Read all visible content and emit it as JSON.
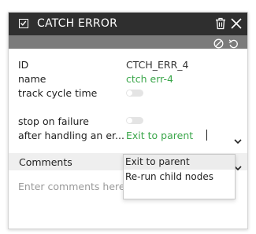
{
  "title_bar": {
    "title": "CATCH ERROR",
    "check_icon": "check-square-icon",
    "trash_icon": "trash-icon",
    "close_icon": "close-icon"
  },
  "sub_toolbar": {
    "disable_icon": "ban-icon",
    "reset_icon": "reset-icon"
  },
  "properties": {
    "id_label": "ID",
    "id_value": "CTCH_ERR_4",
    "name_label": "name",
    "name_value": "ctch err-4",
    "track_label": "track cycle time",
    "stop_label": "stop on failure",
    "after_label": "after handling an er...",
    "after_value": "Exit to parent"
  },
  "toggles": {
    "track_cycle_time": false,
    "stop_on_failure": false
  },
  "comments": {
    "label": "Comments",
    "placeholder": "Enter comments here."
  },
  "dropdown": {
    "options": [
      "Exit to parent",
      "Re-run child nodes"
    ],
    "selected": "Exit to parent"
  },
  "colors": {
    "title_bg": "#2f2f2f",
    "toolbar_bg": "#7b7b7b",
    "value_green": "#3aa64a"
  }
}
